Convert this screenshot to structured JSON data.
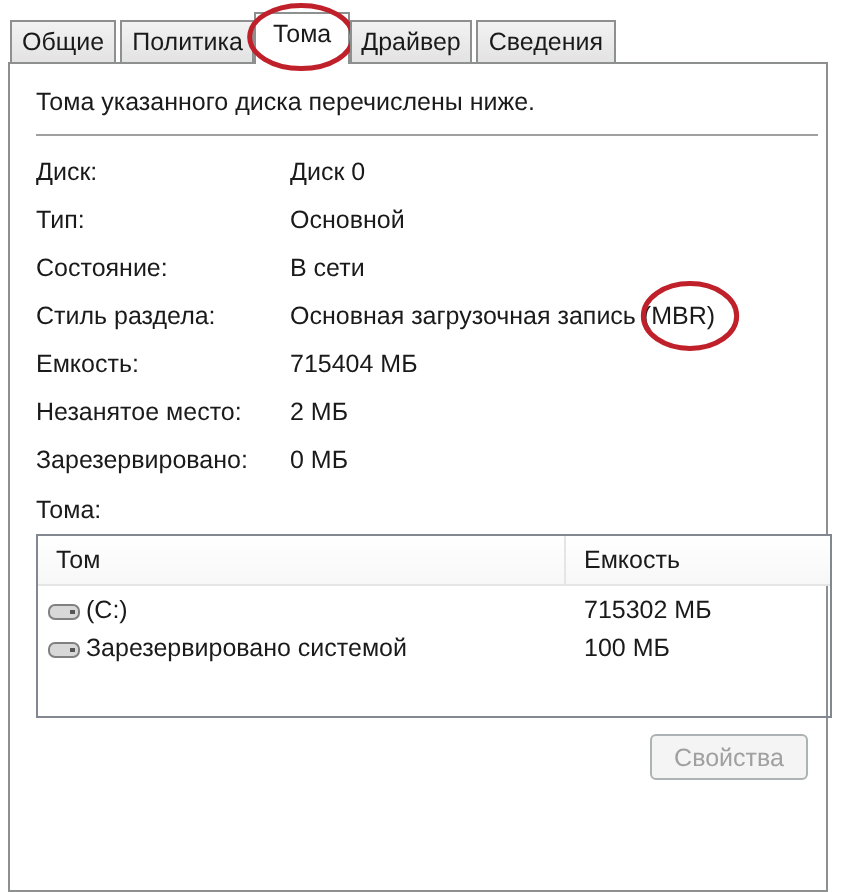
{
  "tabs": [
    {
      "label": "Общие",
      "selected": false,
      "circled": false
    },
    {
      "label": "Политика",
      "selected": false,
      "circled": false
    },
    {
      "label": "Тома",
      "selected": true,
      "circled": true
    },
    {
      "label": "Драйвер",
      "selected": false,
      "circled": false
    },
    {
      "label": "Сведения",
      "selected": false,
      "circled": false
    }
  ],
  "intro": "Тома указанного диска перечислены ниже.",
  "properties": [
    {
      "label": "Диск:",
      "value": "Диск 0",
      "circled": false
    },
    {
      "label": "Тип:",
      "value": "Основной",
      "circled": false
    },
    {
      "label": "Состояние:",
      "value": "В сети",
      "circled": false
    },
    {
      "label": "Стиль раздела:",
      "value": "Основная загрузочная запись (MBR)",
      "circled": true
    },
    {
      "label": "Емкость:",
      "value": "715404 МБ",
      "circled": false
    },
    {
      "label": "Незанятое место:",
      "value": "2 МБ",
      "circled": false
    },
    {
      "label": "Зарезервировано:",
      "value": "0 МБ",
      "circled": false
    }
  ],
  "volumes_label": "Тома:",
  "volumes": {
    "columns": [
      "Том",
      "Емкость"
    ],
    "rows": [
      {
        "name": "(C:)",
        "capacity": "715302 МБ"
      },
      {
        "name": "Зарезервировано системой",
        "capacity": "100 МБ"
      }
    ]
  },
  "button": {
    "label": "Свойства",
    "disabled": true
  }
}
